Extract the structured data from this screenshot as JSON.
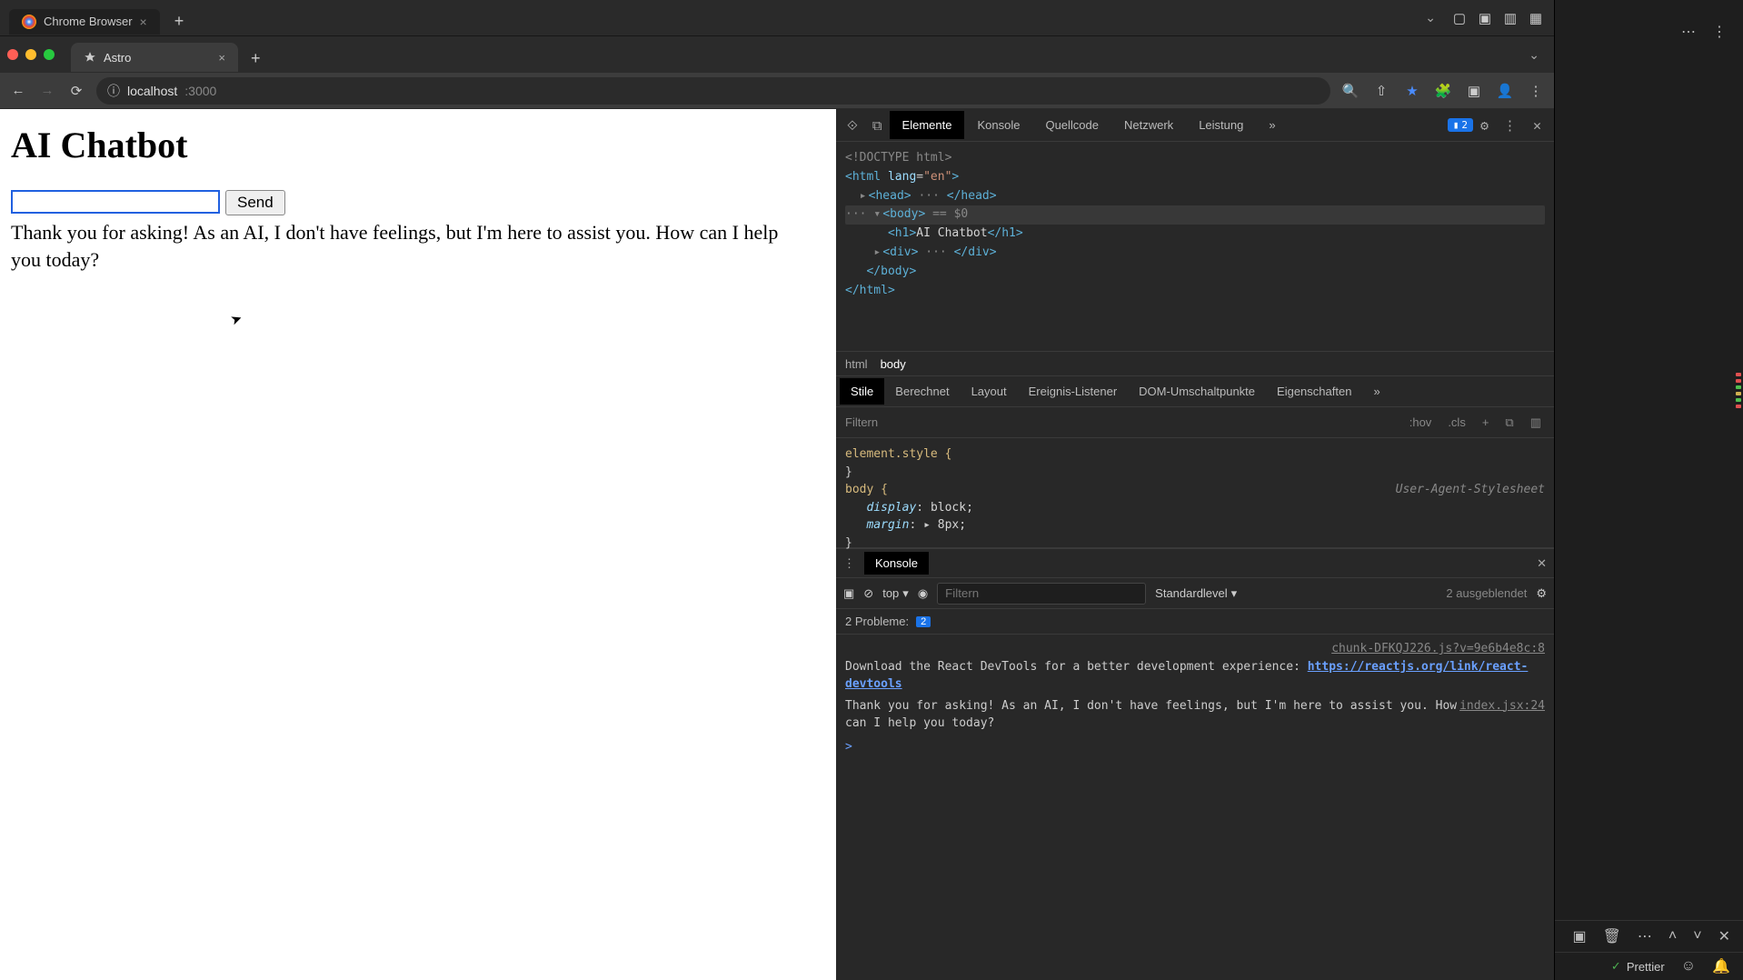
{
  "outer_tabbar": {
    "tab_title": "Chrome Browser",
    "close": "×",
    "plus": "+",
    "chevron": "⌄"
  },
  "chrome": {
    "tab_title": "Astro",
    "tab_close": "×",
    "plus": "+",
    "chevron": "⌄",
    "nav": {
      "back": "←",
      "forward": "→",
      "reload": "⟳"
    },
    "url": {
      "secure_icon": "ⓘ",
      "host": "localhost",
      "path": ":3000"
    },
    "toolbar_right": {
      "zoom": "🔍",
      "share": "⇧",
      "bookmark": "★",
      "extensions": "🧩",
      "panel": "▣",
      "profile": "👤",
      "menu": "⋮"
    }
  },
  "page": {
    "heading": "AI Chatbot",
    "input_value": "",
    "send_label": "Send",
    "response": "Thank you for asking! As an AI, I don't have feelings, but I'm here to assist you. How can I help you today?"
  },
  "devtools": {
    "tabs": {
      "inspect_icon": "⟐",
      "device_icon": "⧉",
      "elements": "Elemente",
      "console": "Konsole",
      "sources": "Quellcode",
      "network": "Netzwerk",
      "performance": "Leistung",
      "more": "»",
      "issue_count": "2",
      "settings": "⚙",
      "menu": "⋮",
      "close": "✕"
    },
    "dom": {
      "doctype": "<!DOCTYPE html>",
      "html_open": "<html lang=\"en\">",
      "head": "<head> ··· </head>",
      "body_open": "<body>",
      "body_badge": "== $0",
      "h1_open": "<h1>",
      "h1_text": "AI Chatbot",
      "h1_close": "</h1>",
      "div": "<div> ··· </div>",
      "body_close": "</body>",
      "html_close": "</html>"
    },
    "breadcrumb": {
      "html": "html",
      "body": "body"
    },
    "styles_tabs": {
      "styles": "Stile",
      "computed": "Berechnet",
      "layout": "Layout",
      "listeners": "Ereignis-Listener",
      "dom_breakpoints": "DOM-Umschaltpunkte",
      "properties": "Eigenschaften",
      "more": "»"
    },
    "styles_filter": {
      "label": "Filtern",
      "hov": ":hov",
      "cls": ".cls",
      "plus": "+",
      "t1": "⧉",
      "t2": "▥"
    },
    "css": {
      "elem_style": "element.style {",
      "elem_style_close": "}",
      "body_sel": "body {",
      "ua_source": "User-Agent-Stylesheet",
      "display_prop": "display",
      "display_val": "block;",
      "margin_prop": "margin",
      "margin_val": "8px;",
      "close": "}"
    },
    "console": {
      "drawer_menu": "⋮",
      "drawer_tab": "Konsole",
      "drawer_close": "✕",
      "side_icon": "▣",
      "clear_icon": "⊘",
      "context": "top",
      "ctx_chevron": "▾",
      "eye": "◉",
      "filter_placeholder": "Filtern",
      "level": "Standardlevel",
      "level_chevron": "▾",
      "hidden": "2 ausgeblendet",
      "gear": "⚙",
      "issues_label": "2 Probleme:",
      "issues_count": "2",
      "src1": "chunk-DFKQJ226.js?v=9e6b4e8c:8",
      "msg1a": "Download the React DevTools for a better development experience: ",
      "msg1b": "https://reactjs.org/link/react-devtools",
      "src2": "index.jsx:24",
      "msg2": "Thank you for asking! As an AI, I don't have feelings, but I'm here to assist you. How can I help you today?",
      "prompt": ">"
    }
  },
  "vscode": {
    "top_icons": {
      "layout1": "▢",
      "layout2": "▣",
      "layout3": "▥",
      "layout4": "▦"
    },
    "panel_icons": {
      "side": "▣",
      "trash": "🗑",
      "more": "⋯",
      "up": "˄",
      "down": "˅",
      "close": "✕"
    },
    "status": {
      "prettier_check": "✓",
      "prettier": "Prettier",
      "feedback": "☺",
      "bell": "🔔"
    }
  }
}
